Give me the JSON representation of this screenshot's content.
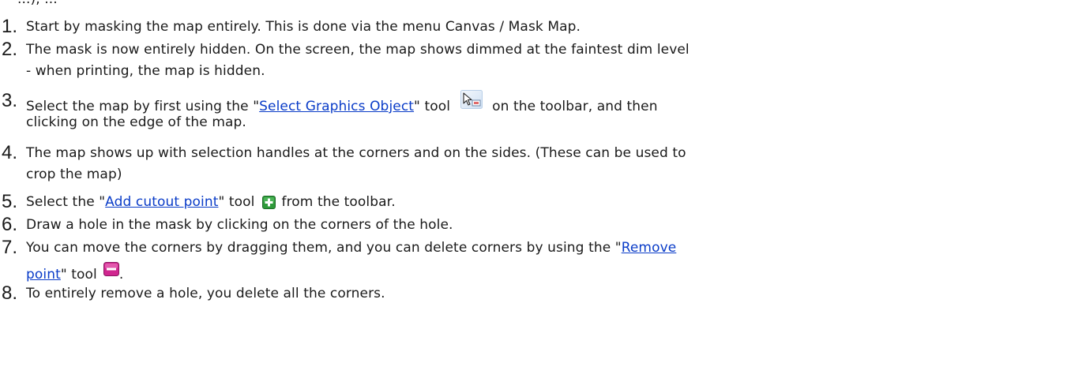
{
  "fragment": "...), ...",
  "steps": [
    {
      "number": "1.",
      "text": "Start by masking the map entirely. This is done via the menu  Canvas / Mask Map."
    },
    {
      "number": "2.",
      "text_line1": "The mask is now entirely hidden. On the screen, the map shows dimmed at the faintest dim level",
      "text_line2": "- when printing, the map is hidden."
    },
    {
      "number": "3.",
      "text_before": "Select the map by first using the \"",
      "link": "Select Graphics Object",
      "text_after_link": "\" tool",
      "icon": "select-graphics-object-icon",
      "text_after_icon": "on the toolbar, and then",
      "text_line2": "clicking on the edge of the map."
    },
    {
      "number": "4.",
      "text_line1": "The map shows up with selection handles at the corners and on the sides.  (These can be used to",
      "text_line2": "crop the map)"
    },
    {
      "number": "5.",
      "text_before": "Select the \"",
      "link": "Add cutout point",
      "text_after_link": "\" tool",
      "icon": "add-cutout-point-icon",
      "text_after_icon": "from the toolbar."
    },
    {
      "number": "6.",
      "text": "Draw a hole in the mask by clicking on the corners of the hole."
    },
    {
      "number": "7.",
      "text_before": "You can move the corners by dragging them, and you can delete corners by using the \"",
      "link_part1": "Remove",
      "link_part2": "point",
      "text_after_link": "\" tool",
      "icon": "remove-point-icon",
      "text_end": "."
    },
    {
      "number": "8.",
      "text": "To entirely remove a hole, you delete all the corners."
    }
  ],
  "colors": {
    "link": "#0a3cc8",
    "text": "#1a1a1a",
    "add_icon": "#2e9a3a",
    "remove_icon": "#d0268f"
  }
}
